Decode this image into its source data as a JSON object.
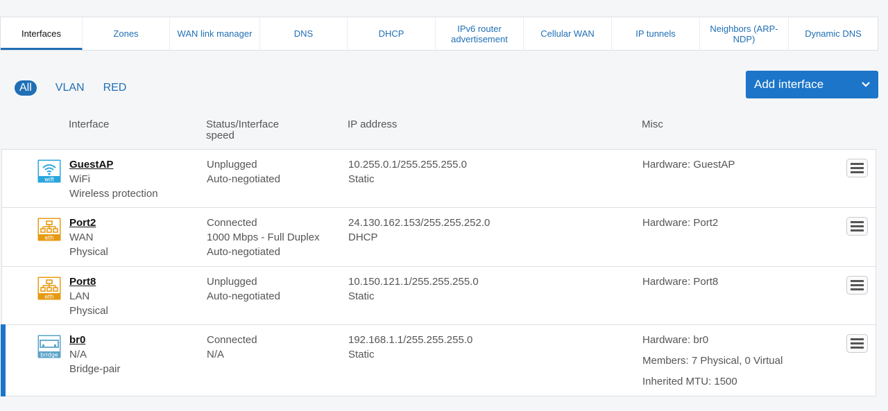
{
  "tabs": [
    {
      "label": "Interfaces",
      "active": true
    },
    {
      "label": "Zones"
    },
    {
      "label": "WAN link manager"
    },
    {
      "label": "DNS"
    },
    {
      "label": "DHCP"
    },
    {
      "label": "IPv6 router advertisement"
    },
    {
      "label": "Cellular WAN"
    },
    {
      "label": "IP tunnels"
    },
    {
      "label": "Neighbors (ARP-NDP)"
    },
    {
      "label": "Dynamic DNS"
    }
  ],
  "filters": {
    "all": "All",
    "vlan": "VLAN",
    "red": "RED"
  },
  "add_button": {
    "label": "Add interface"
  },
  "columns": {
    "interface": "Interface",
    "status": "Status/Interface speed",
    "ip": "IP address",
    "misc": "Misc"
  },
  "colors": {
    "accent": "#1c75c8",
    "wifi_icon": "#2aa6dc",
    "eth_icon": "#e69a12",
    "bridge_icon": "#5aa3c8"
  },
  "rows": [
    {
      "icon": "wifi-icon",
      "icon_label": "wifi",
      "name": "GuestAP",
      "type": "WiFi",
      "subtype": "Wireless protection",
      "status": "Unplugged",
      "speed": "Auto-negotiated",
      "speed2": "",
      "ip": "10.255.0.1/255.255.255.0",
      "ip_mode": "Static",
      "hardware": "Hardware:  GuestAP"
    },
    {
      "icon": "ethernet-icon",
      "icon_label": "eth",
      "name": "Port2",
      "type": "WAN",
      "subtype": "Physical",
      "status": "Connected",
      "speed": "1000 Mbps - Full Duplex",
      "speed2": "Auto-negotiated",
      "ip": "24.130.162.153/255.255.252.0",
      "ip_mode": "DHCP",
      "hardware": "Hardware:  Port2"
    },
    {
      "icon": "ethernet-icon",
      "icon_label": "eth",
      "name": "Port8",
      "type": "LAN",
      "subtype": "Physical",
      "status": "Unplugged",
      "speed": "Auto-negotiated",
      "speed2": "",
      "ip": "10.150.121.1/255.255.255.0",
      "ip_mode": "Static",
      "hardware": "Hardware:  Port8"
    },
    {
      "icon": "bridge-icon",
      "icon_label": "bridge",
      "name": "br0",
      "type": "N/A",
      "subtype": "Bridge-pair",
      "status": "Connected",
      "speed": "N/A",
      "speed2": "",
      "ip": "192.168.1.1/255.255.255.0",
      "ip_mode": "Static",
      "hardware": "Hardware:  br0",
      "members": "Members: 7 Physical, 0 Virtual",
      "mtu": "Inherited MTU: 1500"
    }
  ]
}
